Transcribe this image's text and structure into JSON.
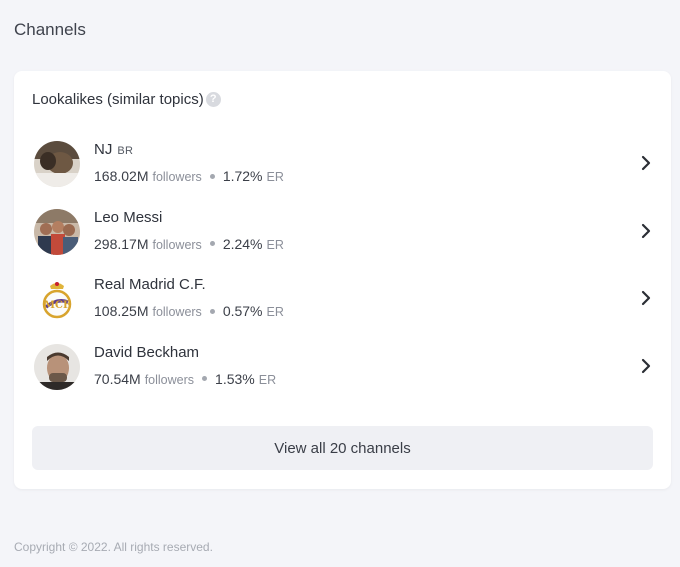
{
  "page": {
    "title": "Channels"
  },
  "card": {
    "title": "Lookalikes (similar topics)",
    "help_icon": "question-circle-icon",
    "items": [
      {
        "name": "NJ",
        "country": "BR",
        "followers": "168.02M",
        "followers_label": "followers",
        "er": "1.72%",
        "er_label": "ER",
        "avatar": "avatar-nj"
      },
      {
        "name": "Leo Messi",
        "country": "",
        "followers": "298.17M",
        "followers_label": "followers",
        "er": "2.24%",
        "er_label": "ER",
        "avatar": "avatar-leo-messi"
      },
      {
        "name": "Real Madrid C.F.",
        "country": "",
        "followers": "108.25M",
        "followers_label": "followers",
        "er": "0.57%",
        "er_label": "ER",
        "avatar": "real-madrid-crest-logo"
      },
      {
        "name": "David Beckham",
        "country": "",
        "followers": "70.54M",
        "followers_label": "followers",
        "er": "1.53%",
        "er_label": "ER",
        "avatar": "avatar-david-beckham"
      }
    ],
    "view_all_label": "View all 20 channels"
  },
  "footer": {
    "copyright": "Copyright © 2022. All rights reserved."
  },
  "colors": {
    "background": "#f4f5f9",
    "card": "#ffffff",
    "button": "#eff0f4",
    "muted": "#8b8f99"
  }
}
